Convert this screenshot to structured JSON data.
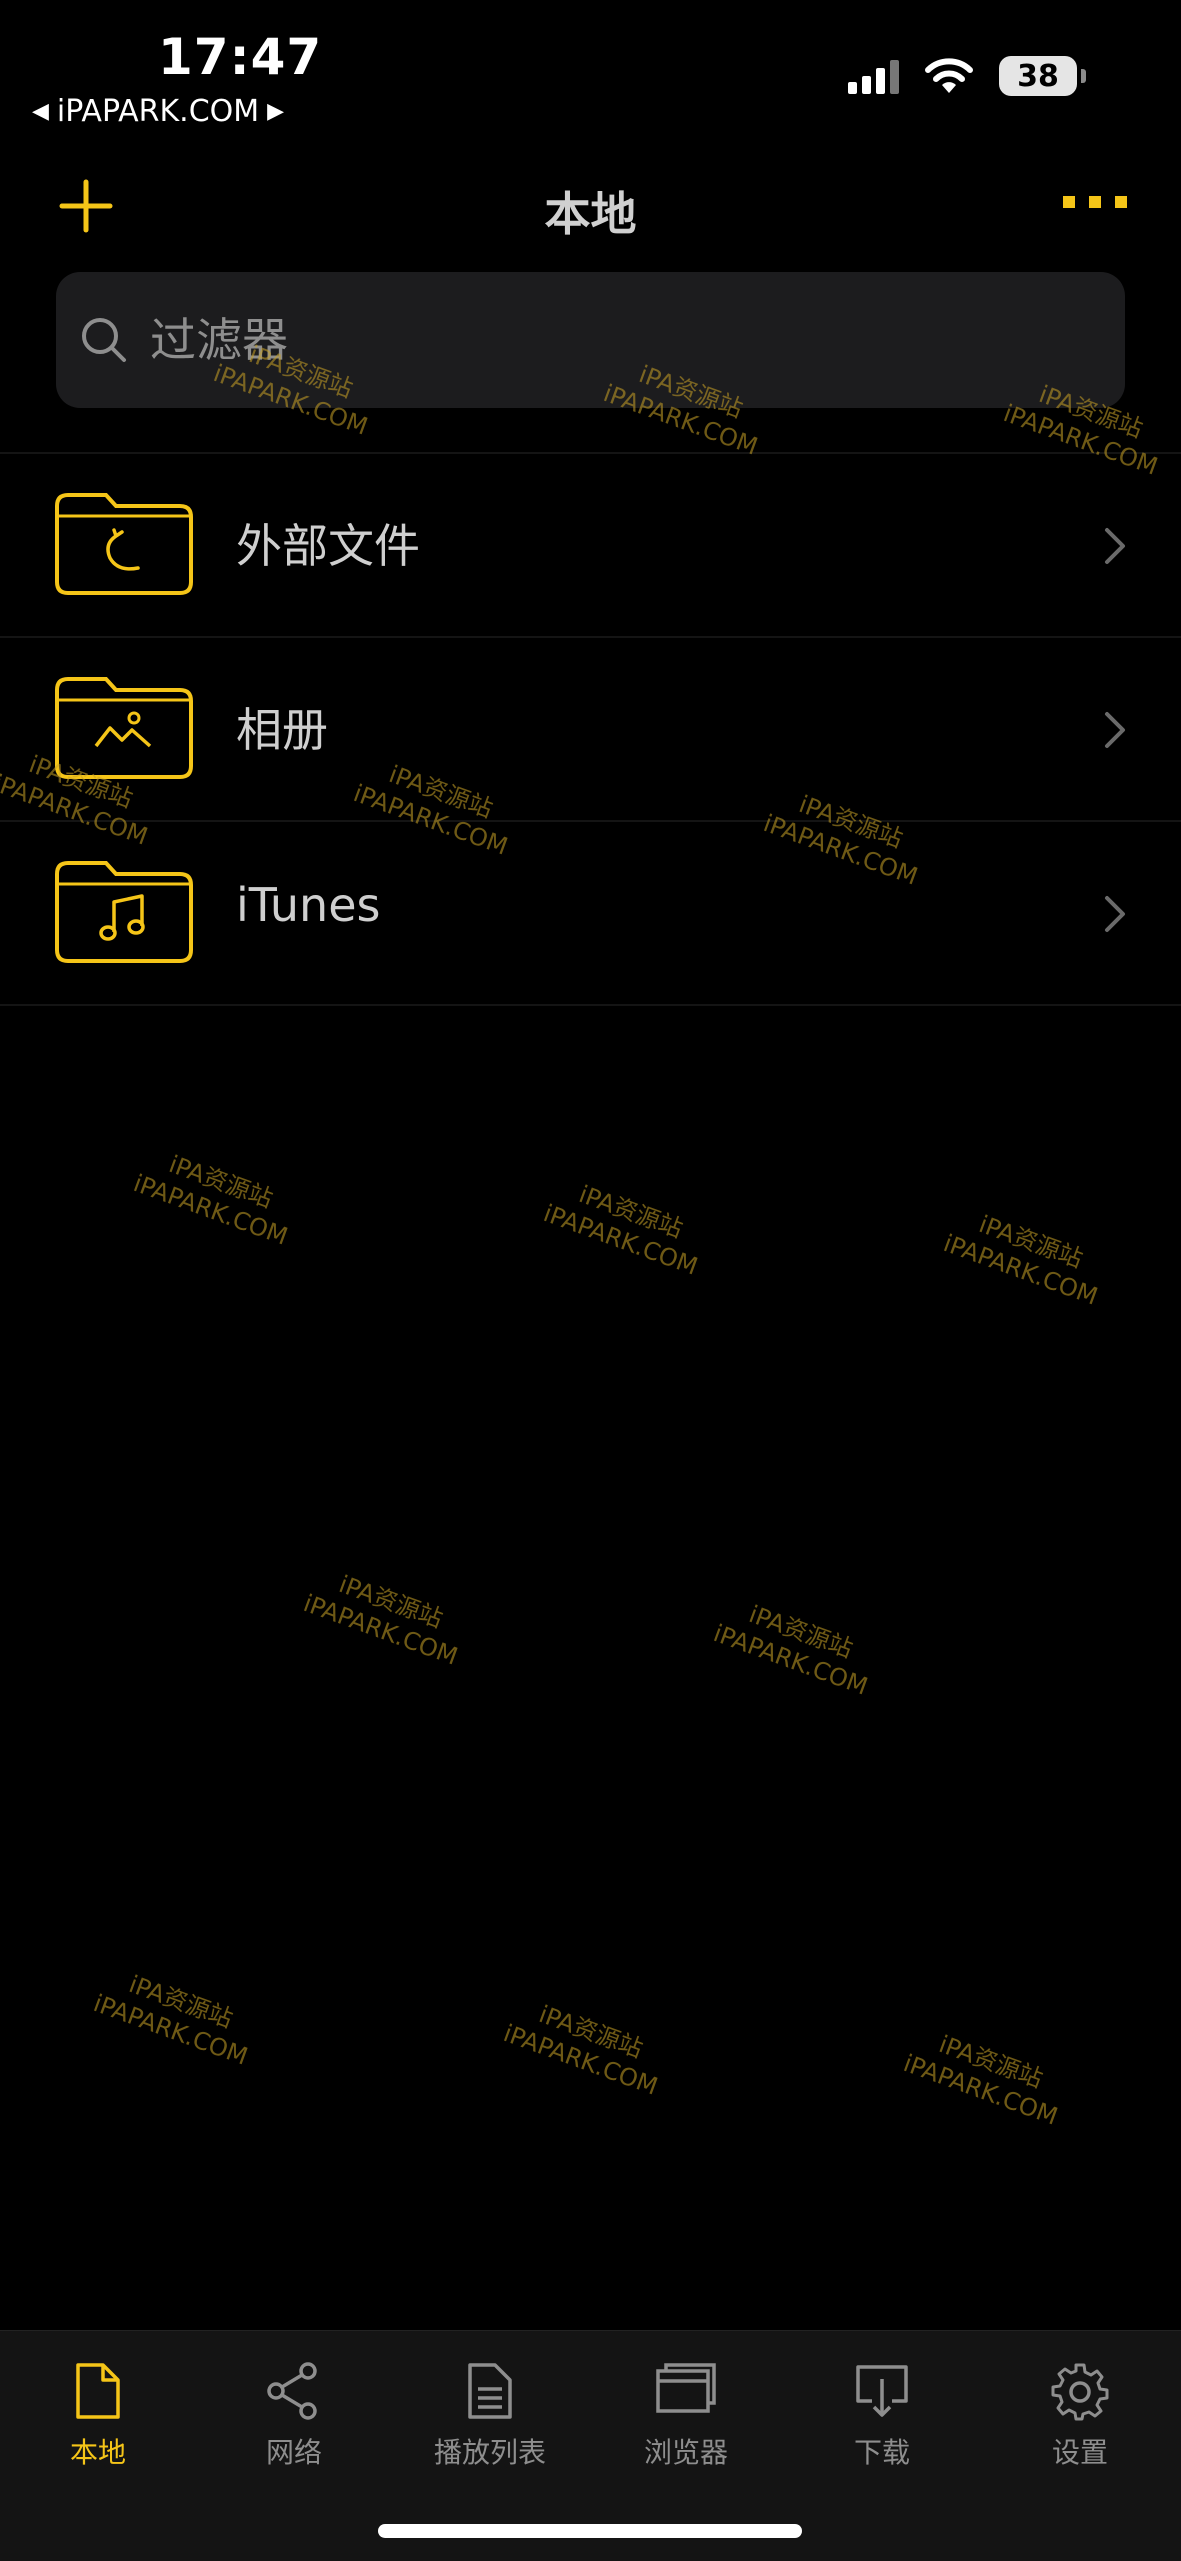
{
  "status_bar": {
    "time": "17:47",
    "back_label": "iPAPARK.COM",
    "battery": "38"
  },
  "nav": {
    "title": "本地"
  },
  "search": {
    "placeholder": "过滤器"
  },
  "list": {
    "items": [
      {
        "label": "外部文件",
        "icon": "folder-sync-icon"
      },
      {
        "label": "相册",
        "icon": "folder-photo-icon"
      },
      {
        "label": "iTunes",
        "icon": "folder-music-icon"
      }
    ]
  },
  "tabs": [
    {
      "label": "本地",
      "icon": "document-icon",
      "active": true
    },
    {
      "label": "网络",
      "icon": "share-icon",
      "active": false
    },
    {
      "label": "播放列表",
      "icon": "list-document-icon",
      "active": false
    },
    {
      "label": "浏览器",
      "icon": "browser-windows-icon",
      "active": false
    },
    {
      "label": "下载",
      "icon": "download-icon",
      "active": false
    },
    {
      "label": "设置",
      "icon": "gear-icon",
      "active": false
    }
  ],
  "watermark": {
    "line1": "iPA资源站",
    "line2": "iPAPARK.COM"
  },
  "colors": {
    "accent": "#f5c518",
    "background": "#000000",
    "tab_bar": "#141414",
    "search_bg": "#1c1c1e"
  }
}
